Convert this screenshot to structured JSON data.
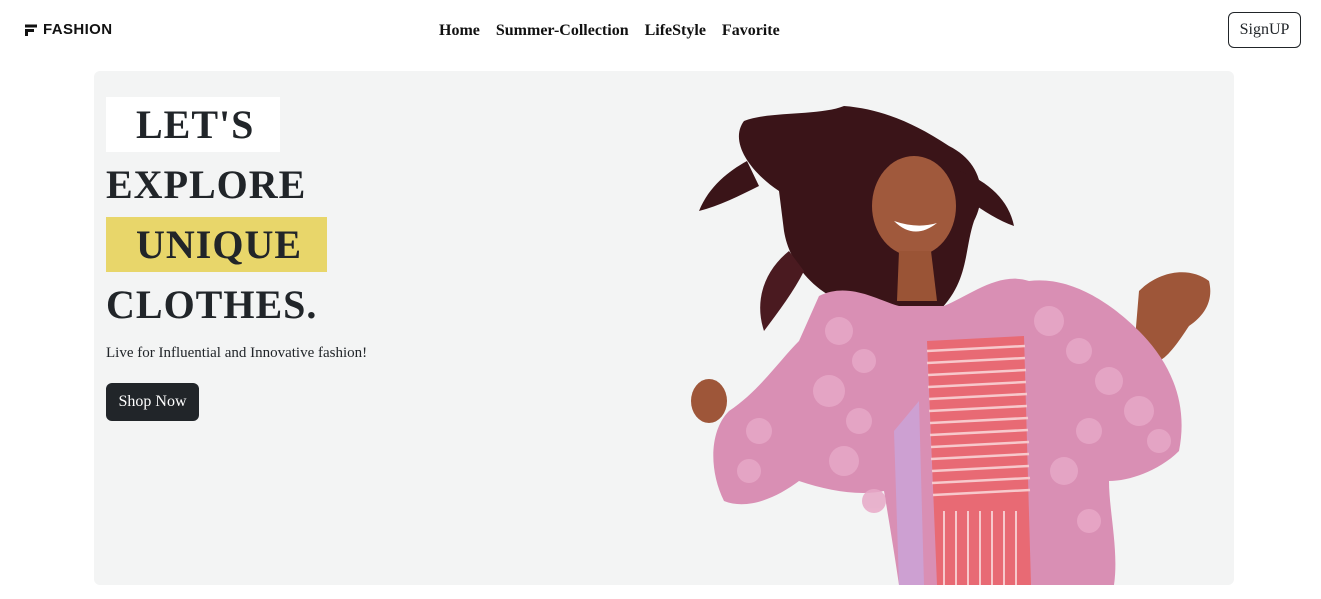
{
  "brand": {
    "name": "FASHION",
    "icon": "brand-logo-icon"
  },
  "nav": {
    "links": [
      {
        "label": "Home"
      },
      {
        "label": "Summer-Collection"
      },
      {
        "label": "LifeStyle"
      },
      {
        "label": "Favorite"
      }
    ],
    "signup_label": "SignUP"
  },
  "hero": {
    "headline": [
      "LET'S",
      "EXPLORE",
      "UNIQUE",
      "CLOTHES."
    ],
    "tagline": "Live for Influential and Innovative fashion!",
    "cta_label": "Shop Now",
    "colors": {
      "panel": "#f3f4f4",
      "highlight": "#e8d66a",
      "button": "#212529"
    }
  }
}
